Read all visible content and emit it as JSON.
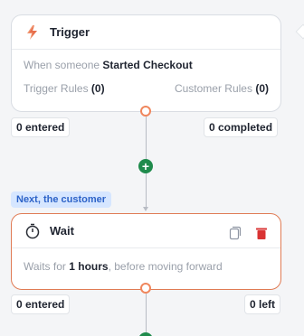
{
  "trigger": {
    "title": "Trigger",
    "condition_prefix": "When someone ",
    "condition_event": "Started Checkout",
    "rules": [
      {
        "label": "Trigger Rules ",
        "count": "(0)"
      },
      {
        "label": "Customer Rules ",
        "count": "(0)"
      }
    ],
    "entered": "0 entered",
    "completed": "0 completed",
    "icon": "bolt-icon"
  },
  "edge": {
    "label": "Next, the customer"
  },
  "wait": {
    "title": "Wait",
    "description_prefix": "Waits for ",
    "duration": "1 hours",
    "description_suffix": ", before moving forward",
    "entered": "0 entered",
    "left": "0 left",
    "icon": "stopwatch-icon"
  },
  "colors": {
    "accent": "#f0875d",
    "add": "#1f8b4c",
    "tag_bg": "#d6e6ff",
    "tag_text": "#2d63c8",
    "delete": "#d93333"
  }
}
